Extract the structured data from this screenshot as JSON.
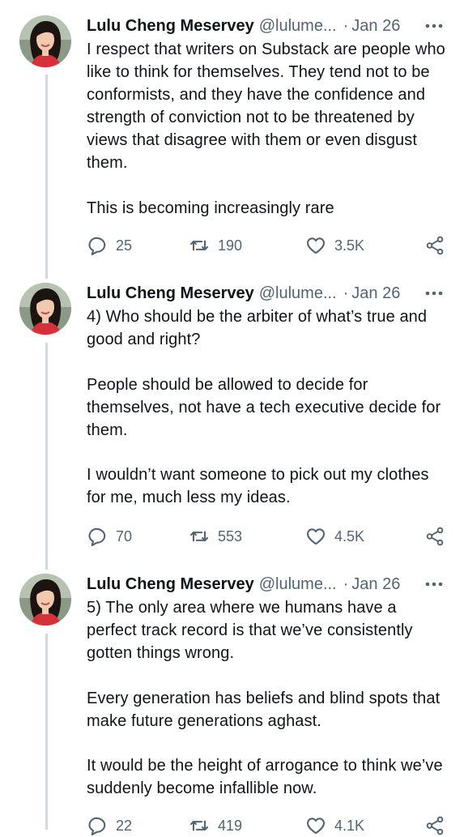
{
  "tweets": [
    {
      "author_name": "Lulu Cheng Meservey",
      "author_handle": "@lulume...",
      "separator": "·",
      "date": "Jan 26",
      "paragraphs": [
        "I respect that writers on Substack are people who like to think for themselves. They tend not to be conformists, and they have the confidence and strength of conviction not to be threatened by views that disagree with them or even disgust them.",
        "This is becoming increasingly rare"
      ],
      "replies": "25",
      "retweets": "190",
      "likes": "3.5K"
    },
    {
      "author_name": "Lulu Cheng Meservey",
      "author_handle": "@lulume...",
      "separator": "·",
      "date": "Jan 26",
      "paragraphs": [
        "4) Who should be the arbiter of what’s true and good and right?",
        "People should be allowed to decide for themselves, not have a tech executive decide for them.",
        "I wouldn’t want someone to pick out my clothes for me, much less my ideas."
      ],
      "replies": "70",
      "retweets": "553",
      "likes": "4.5K"
    },
    {
      "author_name": "Lulu Cheng Meservey",
      "author_handle": "@lulume...",
      "separator": "·",
      "date": "Jan 26",
      "paragraphs": [
        "5) The only area where we humans have a perfect track record is that we’ve consistently gotten things wrong.",
        "Every generation has beliefs and blind spots that make future generations aghast.",
        "It would be the height of arrogance to think we’ve suddenly become infallible now."
      ],
      "replies": "22",
      "retweets": "419",
      "likes": "4.1K"
    }
  ],
  "icons": {
    "more": "more-horizontal-icon",
    "reply": "reply-bubble-icon",
    "retweet": "retweet-arrows-icon",
    "like": "heart-icon",
    "share": "share-nodes-icon"
  },
  "colors": {
    "text": "#0f1419",
    "secondary": "#536471",
    "thread_line": "#cfd9de",
    "background": "#ffffff"
  }
}
